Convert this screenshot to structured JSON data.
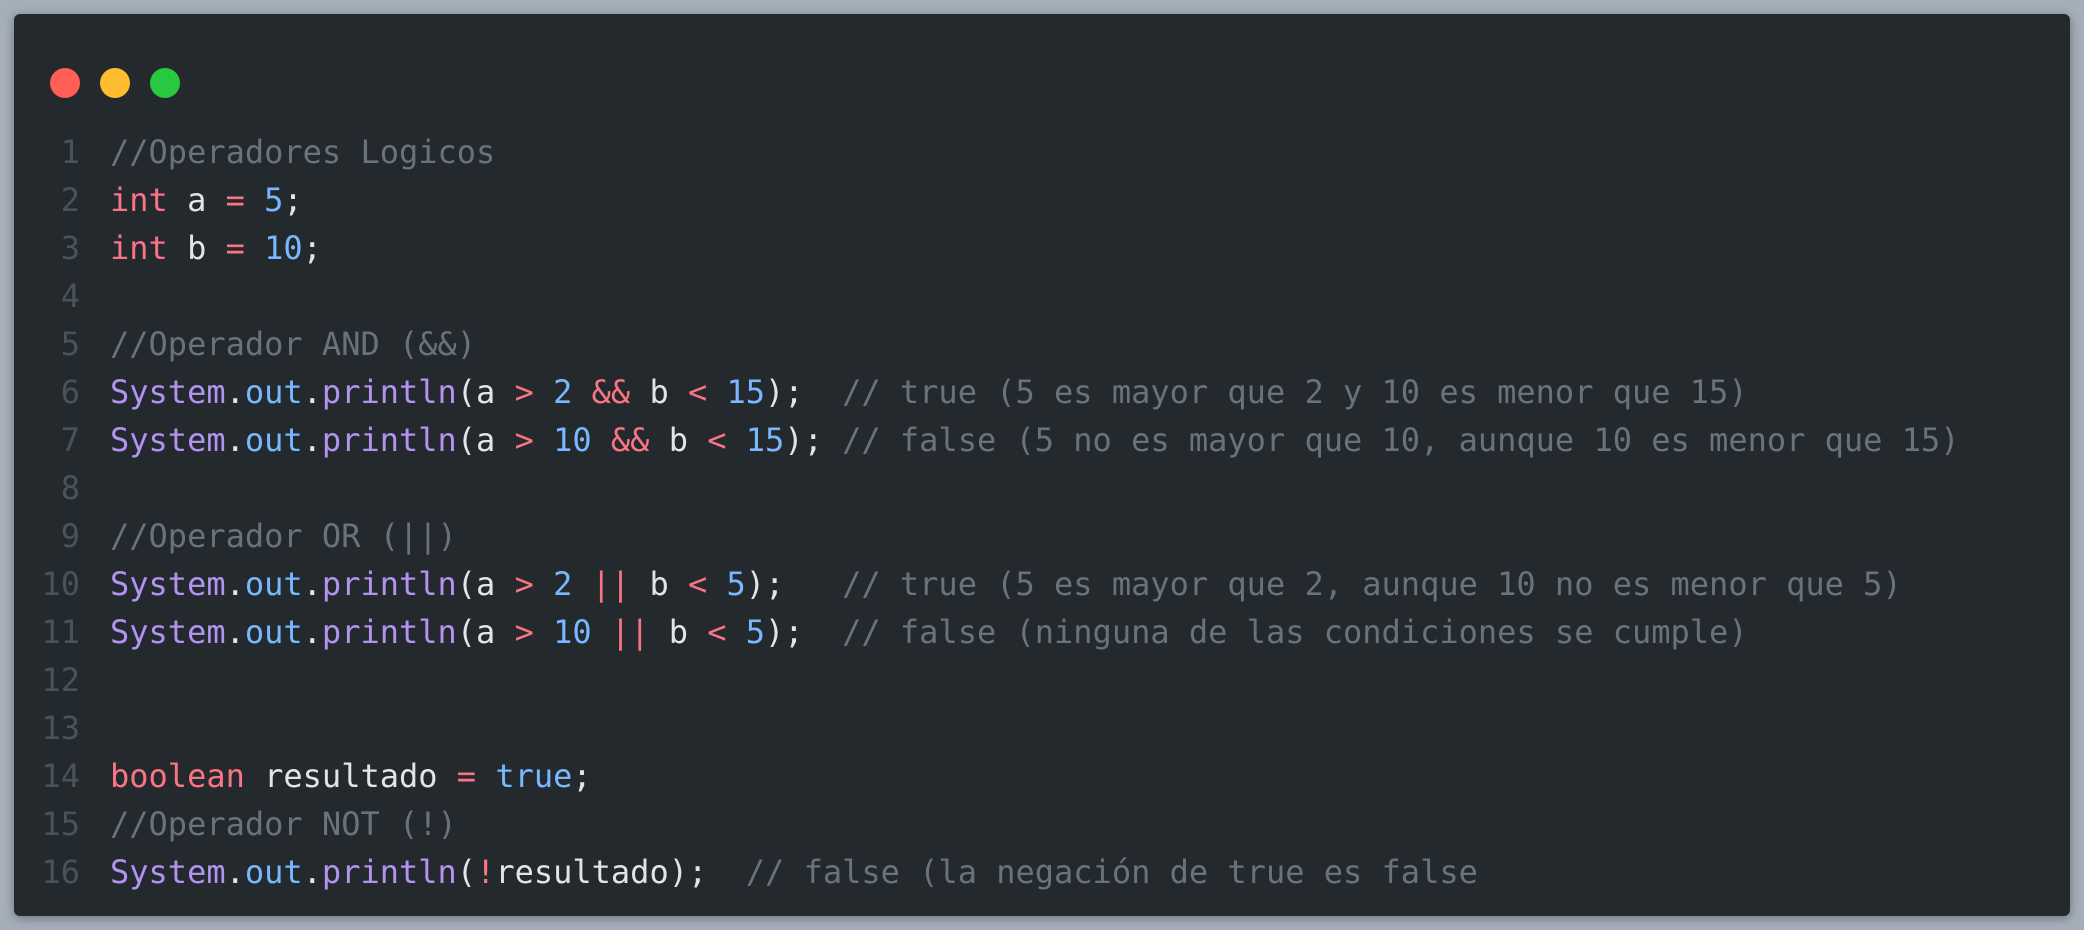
{
  "window": {
    "controls": [
      {
        "name": "close",
        "color": "#ff5f56"
      },
      {
        "name": "minimize",
        "color": "#ffbd2e"
      },
      {
        "name": "maximize",
        "color": "#27c93f"
      }
    ]
  },
  "colors": {
    "background": "#a5afb9",
    "editor": "#24292e",
    "comment": "#6a737d",
    "keyword": "#f97583",
    "number": "#79b8ff",
    "class": "#b392f0",
    "text": "#e1e4e8",
    "line_number": "#4a535c"
  },
  "code": {
    "lines": [
      {
        "number": "1",
        "tokens": [
          {
            "t": "comment",
            "v": "//Operadores Logicos"
          }
        ]
      },
      {
        "number": "2",
        "tokens": [
          {
            "t": "keyword",
            "v": "int"
          },
          {
            "t": "plain",
            "v": " a "
          },
          {
            "t": "op",
            "v": "="
          },
          {
            "t": "plain",
            "v": " "
          },
          {
            "t": "number",
            "v": "5"
          },
          {
            "t": "plain",
            "v": ";"
          }
        ]
      },
      {
        "number": "3",
        "tokens": [
          {
            "t": "keyword",
            "v": "int"
          },
          {
            "t": "plain",
            "v": " b "
          },
          {
            "t": "op",
            "v": "="
          },
          {
            "t": "plain",
            "v": " "
          },
          {
            "t": "number",
            "v": "10"
          },
          {
            "t": "plain",
            "v": ";"
          }
        ]
      },
      {
        "number": "4",
        "tokens": []
      },
      {
        "number": "5",
        "tokens": [
          {
            "t": "comment",
            "v": "//Operador AND (&&)"
          }
        ]
      },
      {
        "number": "6",
        "tokens": [
          {
            "t": "class",
            "v": "System"
          },
          {
            "t": "plain",
            "v": "."
          },
          {
            "t": "field",
            "v": "out"
          },
          {
            "t": "plain",
            "v": "."
          },
          {
            "t": "method",
            "v": "println"
          },
          {
            "t": "plain",
            "v": "(a "
          },
          {
            "t": "op",
            "v": ">"
          },
          {
            "t": "plain",
            "v": " "
          },
          {
            "t": "number",
            "v": "2"
          },
          {
            "t": "plain",
            "v": " "
          },
          {
            "t": "op",
            "v": "&&"
          },
          {
            "t": "plain",
            "v": " b "
          },
          {
            "t": "op",
            "v": "<"
          },
          {
            "t": "plain",
            "v": " "
          },
          {
            "t": "number",
            "v": "15"
          },
          {
            "t": "plain",
            "v": ");  "
          },
          {
            "t": "comment",
            "v": "// true (5 es mayor que 2 y 10 es menor que 15)"
          }
        ]
      },
      {
        "number": "7",
        "tokens": [
          {
            "t": "class",
            "v": "System"
          },
          {
            "t": "plain",
            "v": "."
          },
          {
            "t": "field",
            "v": "out"
          },
          {
            "t": "plain",
            "v": "."
          },
          {
            "t": "method",
            "v": "println"
          },
          {
            "t": "plain",
            "v": "(a "
          },
          {
            "t": "op",
            "v": ">"
          },
          {
            "t": "plain",
            "v": " "
          },
          {
            "t": "number",
            "v": "10"
          },
          {
            "t": "plain",
            "v": " "
          },
          {
            "t": "op",
            "v": "&&"
          },
          {
            "t": "plain",
            "v": " b "
          },
          {
            "t": "op",
            "v": "<"
          },
          {
            "t": "plain",
            "v": " "
          },
          {
            "t": "number",
            "v": "15"
          },
          {
            "t": "plain",
            "v": "); "
          },
          {
            "t": "comment",
            "v": "// false (5 no es mayor que 10, aunque 10 es menor que 15)"
          }
        ]
      },
      {
        "number": "8",
        "tokens": []
      },
      {
        "number": "9",
        "tokens": [
          {
            "t": "comment",
            "v": "//Operador OR (||)"
          }
        ]
      },
      {
        "number": "10",
        "tokens": [
          {
            "t": "class",
            "v": "System"
          },
          {
            "t": "plain",
            "v": "."
          },
          {
            "t": "field",
            "v": "out"
          },
          {
            "t": "plain",
            "v": "."
          },
          {
            "t": "method",
            "v": "println"
          },
          {
            "t": "plain",
            "v": "(a "
          },
          {
            "t": "op",
            "v": ">"
          },
          {
            "t": "plain",
            "v": " "
          },
          {
            "t": "number",
            "v": "2"
          },
          {
            "t": "plain",
            "v": " "
          },
          {
            "t": "op",
            "v": "||"
          },
          {
            "t": "plain",
            "v": " b "
          },
          {
            "t": "op",
            "v": "<"
          },
          {
            "t": "plain",
            "v": " "
          },
          {
            "t": "number",
            "v": "5"
          },
          {
            "t": "plain",
            "v": ");   "
          },
          {
            "t": "comment",
            "v": "// true (5 es mayor que 2, aunque 10 no es menor que 5)"
          }
        ]
      },
      {
        "number": "11",
        "tokens": [
          {
            "t": "class",
            "v": "System"
          },
          {
            "t": "plain",
            "v": "."
          },
          {
            "t": "field",
            "v": "out"
          },
          {
            "t": "plain",
            "v": "."
          },
          {
            "t": "method",
            "v": "println"
          },
          {
            "t": "plain",
            "v": "(a "
          },
          {
            "t": "op",
            "v": ">"
          },
          {
            "t": "plain",
            "v": " "
          },
          {
            "t": "number",
            "v": "10"
          },
          {
            "t": "plain",
            "v": " "
          },
          {
            "t": "op",
            "v": "||"
          },
          {
            "t": "plain",
            "v": " b "
          },
          {
            "t": "op",
            "v": "<"
          },
          {
            "t": "plain",
            "v": " "
          },
          {
            "t": "number",
            "v": "5"
          },
          {
            "t": "plain",
            "v": ");  "
          },
          {
            "t": "comment",
            "v": "// false (ninguna de las condiciones se cumple)"
          }
        ]
      },
      {
        "number": "12",
        "tokens": []
      },
      {
        "number": "13",
        "tokens": []
      },
      {
        "number": "14",
        "tokens": [
          {
            "t": "keyword",
            "v": "boolean"
          },
          {
            "t": "plain",
            "v": " resultado "
          },
          {
            "t": "op",
            "v": "="
          },
          {
            "t": "plain",
            "v": " "
          },
          {
            "t": "bool",
            "v": "true"
          },
          {
            "t": "plain",
            "v": ";"
          }
        ]
      },
      {
        "number": "15",
        "tokens": [
          {
            "t": "comment",
            "v": "//Operador NOT (!)"
          }
        ]
      },
      {
        "number": "16",
        "tokens": [
          {
            "t": "class",
            "v": "System"
          },
          {
            "t": "plain",
            "v": "."
          },
          {
            "t": "field",
            "v": "out"
          },
          {
            "t": "plain",
            "v": "."
          },
          {
            "t": "method",
            "v": "println"
          },
          {
            "t": "plain",
            "v": "("
          },
          {
            "t": "op",
            "v": "!"
          },
          {
            "t": "plain",
            "v": "resultado);  "
          },
          {
            "t": "comment",
            "v": "// false (la negación de true es false"
          }
        ]
      }
    ]
  }
}
